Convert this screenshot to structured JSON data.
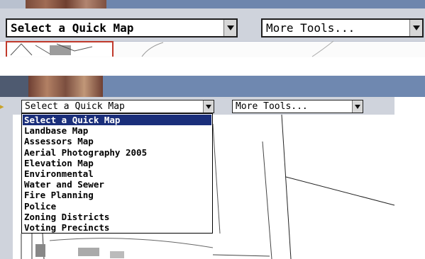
{
  "top_panel": {
    "quick_map_select": {
      "value": "Select a Quick Map"
    },
    "tools_select": {
      "value": "More Tools..."
    }
  },
  "bottom_panel": {
    "quick_map_select": {
      "value": "Select a Quick Map"
    },
    "tools_select": {
      "value": "More Tools..."
    },
    "dropdown_options": [
      "Select a Quick Map",
      "Landbase Map",
      "Assessors Map",
      "Aerial Photography 2005",
      "Elevation Map",
      "Environmental",
      "Water and Sewer",
      "Fire Planning",
      "Police",
      "Zoning Districts",
      "Voting Precincts"
    ],
    "selected_index": 0
  },
  "icons": {
    "dropdown_arrow": "chevron-down-icon"
  },
  "colors": {
    "toolbar_bg": "#cfd3dc",
    "header_blue": "#6f88b0",
    "selection_bg": "#1a2e7a"
  }
}
